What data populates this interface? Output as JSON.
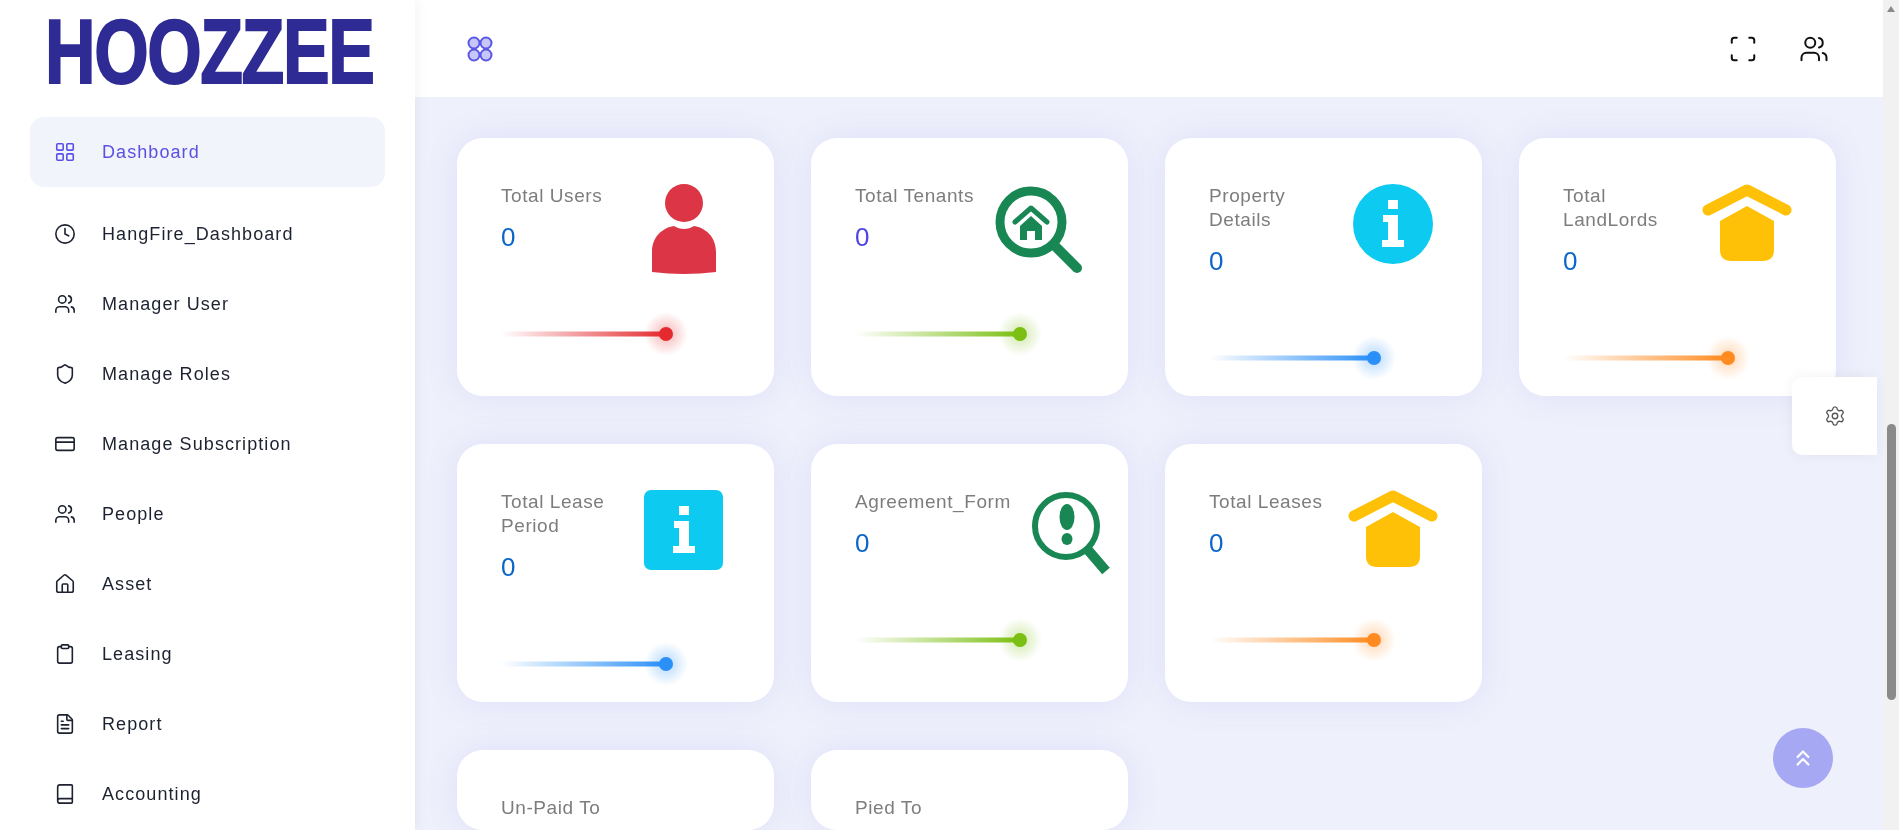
{
  "logo": {
    "text": "HOOZZEE"
  },
  "sidebar": {
    "items": [
      {
        "label": "Dashboard",
        "selected": true
      },
      {
        "label": "HangFire_Dashboard",
        "selected": false
      },
      {
        "label": "Manager User",
        "selected": false
      },
      {
        "label": "Manage Roles",
        "selected": false
      },
      {
        "label": "Manage Subscription",
        "selected": false
      },
      {
        "label": "People",
        "selected": false
      },
      {
        "label": "Asset",
        "selected": false
      },
      {
        "label": "Leasing",
        "selected": false
      },
      {
        "label": "Report",
        "selected": false
      },
      {
        "label": "Accounting",
        "selected": false
      }
    ]
  },
  "card_rows": [
    [
      {
        "title": "Total Users",
        "value": {
          "text": "0",
          "color": "#0b66c9"
        },
        "icon": {
          "color": "#dc3545"
        },
        "line": {
          "color": "#e42a2f"
        }
      },
      {
        "title": "Total Tenants",
        "value": {
          "text": "0",
          "color": "#4f45e4"
        },
        "icon": {
          "color": "#198754"
        },
        "line": {
          "color": "#7bbf12"
        }
      },
      {
        "title": "Property Details",
        "value": {
          "text": "0",
          "color": "#0b66c9"
        },
        "icon": {
          "color": "#0dcaf0"
        },
        "line": {
          "color": "#2a8ff7"
        }
      },
      {
        "title": "Total LandLords",
        "value": {
          "text": "0",
          "color": "#0b66c9"
        },
        "icon": {
          "color": "#ffc107"
        },
        "line": {
          "color": "#ff8a1f"
        }
      }
    ],
    [
      {
        "title": "Total Lease Period",
        "value": {
          "text": "0",
          "color": "#0b66c9"
        },
        "icon": {
          "color": "#0dcaf0"
        },
        "line": {
          "color": "#2a8ff7"
        }
      },
      {
        "title": "Agreement_Form",
        "value": {
          "text": "0",
          "color": "#0b66c9"
        },
        "icon": {
          "color": "#198754"
        },
        "line": {
          "color": "#7bbf12"
        }
      },
      {
        "title": "Total Leases",
        "value": {
          "text": "0",
          "color": "#0b66c9"
        },
        "icon": {
          "color": "#ffc107"
        },
        "line": {
          "color": "#ff8a1f"
        }
      }
    ],
    [
      {
        "title": "Un-Paid To"
      },
      {
        "title": "Pied To"
      }
    ]
  ]
}
